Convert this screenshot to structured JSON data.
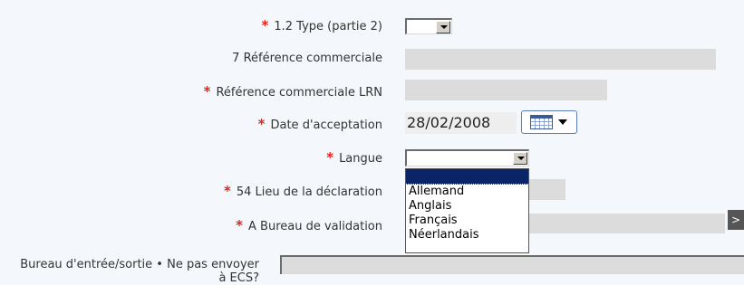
{
  "form": {
    "type_label": "1.2 Type (partie 2)",
    "ref_commerciale_label": "7 Référence commerciale",
    "ref_lrn_label": "Référence commerciale LRN",
    "date_label": "Date d'acceptation",
    "date_value": "28/02/2008",
    "langue_label": "Langue",
    "lieu_label": "54 Lieu de la déclaration",
    "bureau_label": "A Bureau de validation",
    "bureau_button": ">",
    "bureau_entree_label": "Bureau d'entrée/sortie • Ne pas envoyer à ECS?",
    "required_mark": "*"
  },
  "langue_dropdown": {
    "selected": "",
    "options": [
      "Allemand",
      "Anglais",
      "Français",
      "Néerlandais"
    ]
  },
  "colors": {
    "required": "#e0261f",
    "highlight": "#0a246a",
    "field_bg": "#dcdcdc"
  }
}
